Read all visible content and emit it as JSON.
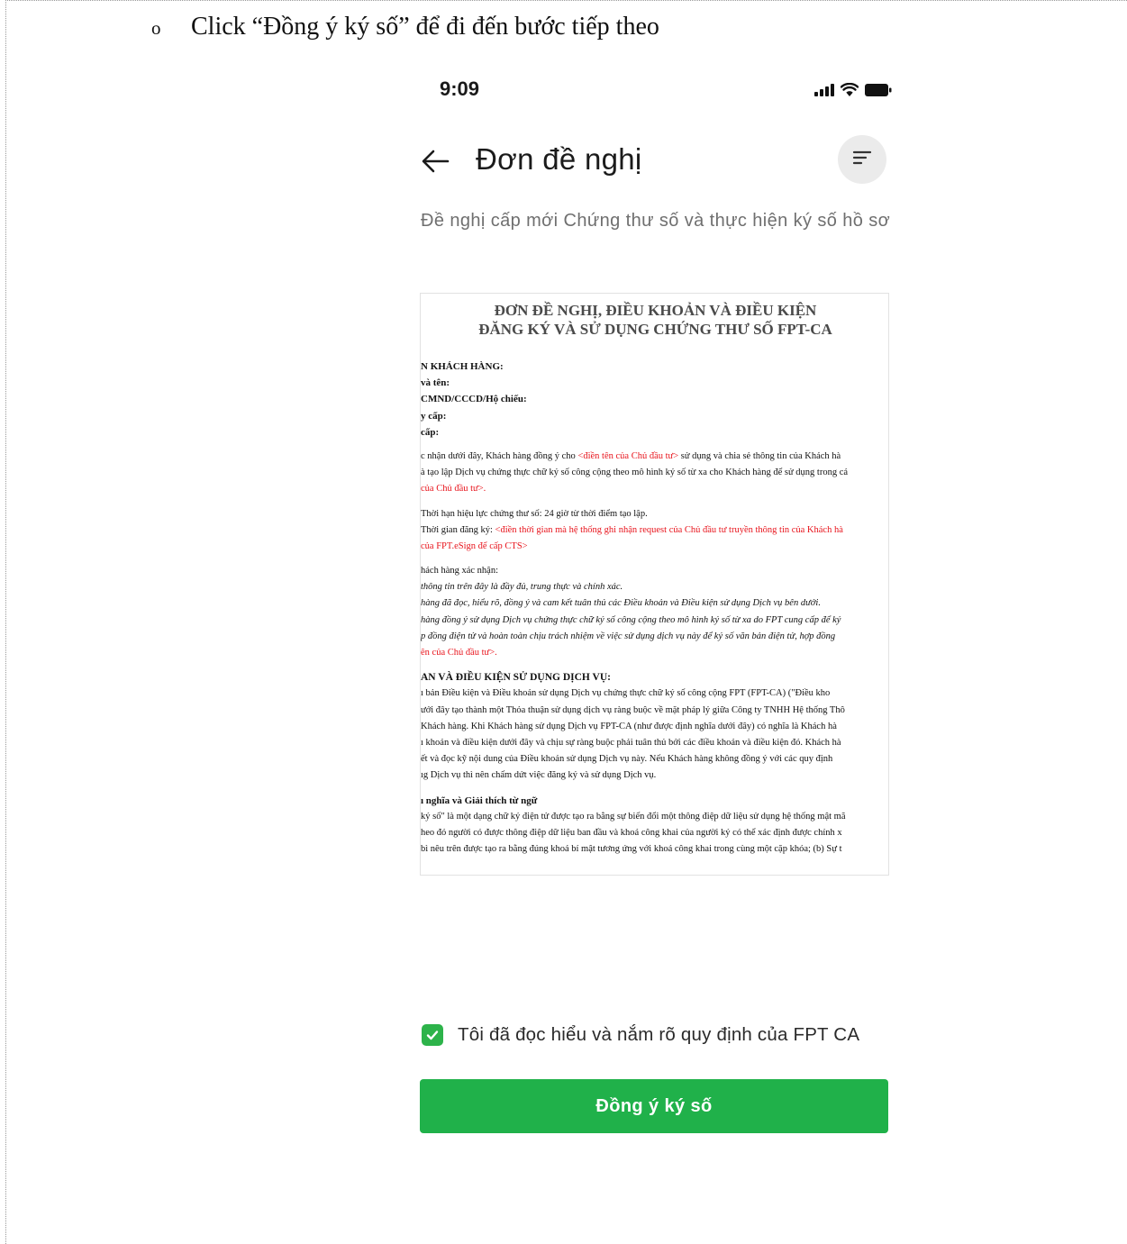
{
  "instruction": {
    "bullet": "o",
    "text": "Click “Đồng ý ký số” để đi đến bước tiếp theo"
  },
  "status_bar": {
    "time": "9:09",
    "icons": [
      "signal-icon",
      "wifi-icon",
      "battery-icon"
    ]
  },
  "header": {
    "title": "Đơn đề nghị",
    "back_icon": "back-arrow-icon",
    "filter_icon": "filter-icon"
  },
  "subtitle": "Đề nghị cấp mới Chứng thư số và thực hiện ký số hồ sơ",
  "document": {
    "title_line1": "ĐƠN ĐỀ NGHỊ, ĐIỀU KHOẢN VÀ ĐIỀU KIỆN",
    "title_line2": "ĐĂNG KÝ VÀ SỬ DỤNG CHỨNG THƯ SỐ FPT-CA",
    "lines": {
      "l1": "N KHÁCH HÀNG:",
      "l2": "và tên:",
      "l3": "CMND/CCCD/Hộ chiếu:",
      "l4": "y cấp:",
      "l5": "cấp:",
      "l6a": "c nhận dưới đây, Khách hàng đồng ý cho ",
      "l6b": "<điền tên của Chủ đầu tư>",
      "l6c": " sử dụng và chia sẻ thông tin của Khách hà",
      "l7": "à tạo lập Dịch vụ chứng thực chữ ký số công cộng theo mô hình ký số từ xa cho Khách hàng để sử dụng trong cá",
      "l8": "của Chủ đầu tư>.",
      "l9": "Thời hạn hiệu lực chứng thư số: 24 giờ từ thời điểm tạo lập.",
      "l10a": "Thời gian đăng ký: ",
      "l10b": "<điền thời gian mà hệ thống ghi nhận request của Chủ đầu tư truyền thông tin của Khách hà",
      "l11": "của FPT.eSign để cấp CTS>",
      "l12": "hách hàng xác nhận:",
      "l13": "thông tin trên đây là đầy đủ, trung thực và chính xác.",
      "l14": "hàng đã đọc, hiểu rõ, đồng ý và cam kết tuân thủ các Điều khoản và Điều kiện sử dụng Dịch vụ bên dưới.",
      "l15": "hàng đồng ý sử dụng Dịch vụ chứng thực chữ ký số công cộng theo mô hình ký số từ xa do FPT cung cấp để ký",
      "l16": "p đồng điện tử và hoàn toàn chịu trách nhiệm về việc sử dụng dịch vụ này để ký số văn bản điện tử, hợp đồng",
      "l17": "ên của Chủ đầu tư>.",
      "l18": "AN VÀ ĐIỀU KIỆN SỬ DỤNG DỊCH VỤ:",
      "l19": "ı bản Điều kiện và Điều khoản sử dụng Dịch vụ chứng thực chữ ký số công cộng FPT (FPT-CA) (\"Điều kho",
      "l20": "ưới đây tạo thành một Thỏa thuận sử dụng dịch vụ ràng buộc về mặt pháp lý giữa Công ty TNHH Hệ thống Thô",
      "l21": "Khách hàng. Khi Khách hàng sử dụng Dịch vụ FPT-CA (như được định nghĩa dưới đây) có nghĩa là Khách hà",
      "l22": "ı khoản và điều kiện dưới đây và chịu sự ràng buộc phải tuân thủ bởi các điều khoản và điều kiện đó. Khách hà",
      "l23": "ết và đọc kỹ nội dung của Điều khoản sử dụng Dịch vụ này. Nếu Khách hàng không đồng ý với các quy định",
      "l24": "ıg Dịch vụ thì nên chấm dứt việc đăng ký và sử dụng Dịch vụ.",
      "l25": "ı nghĩa và Giải thích từ ngữ",
      "l26": "ký số\" là một dạng chữ ký điện tử được tạo ra bằng sự biến đổi một thông điệp dữ liệu sử dụng hệ thống mật mã",
      "l27": "heo đó người có được thông điệp dữ liệu ban đầu và khoá công khai của người ký có thể xác định được chính x",
      "l28": "bì nêu trên được tạo ra bằng đúng khoá bí mật tương ứng với khoá công khai trong cùng một cặp khóa; (b) Sự t"
    }
  },
  "consent": {
    "checked": true,
    "label": "Tôi đã đọc hiểu và nắm rõ quy định của FPT CA"
  },
  "primary_button": {
    "label": "Đồng ý ký số"
  },
  "colors": {
    "accent_green": "#20b14a",
    "doc_red": "#e8141c",
    "subtitle_gray": "#6f6f6f",
    "filter_bg": "#ebebeb"
  }
}
